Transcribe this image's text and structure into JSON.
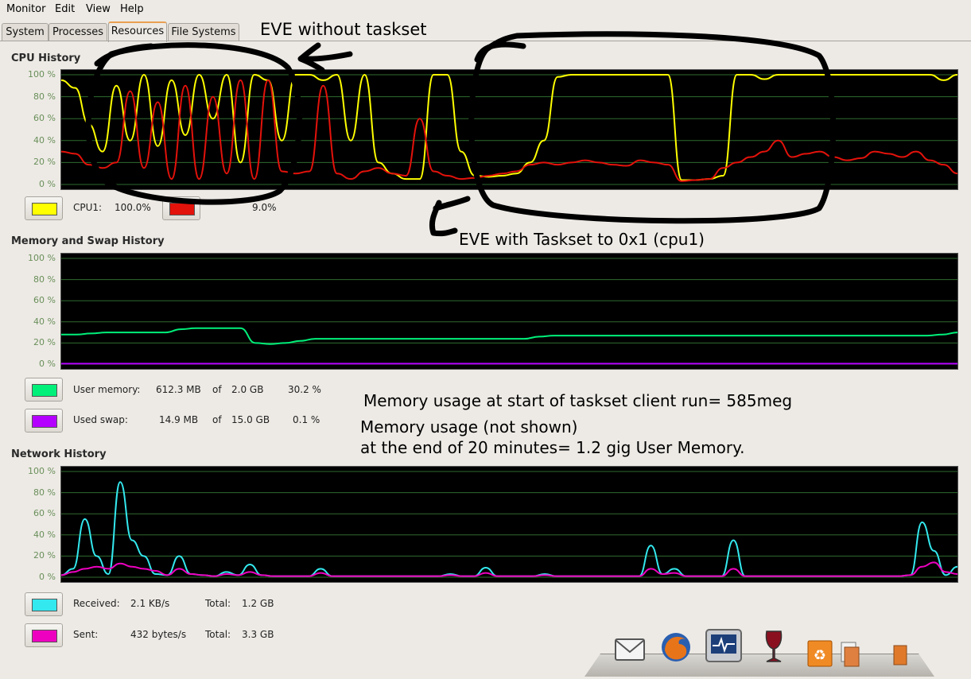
{
  "menu": {
    "monitor": {
      "label": "Monitor"
    },
    "edit": {
      "label": "Edit"
    },
    "view": {
      "label": "View"
    },
    "help": {
      "label": "Help"
    }
  },
  "tabs": [
    {
      "label": "System",
      "active": false
    },
    {
      "label": "Processes",
      "active": false
    },
    {
      "label": "Resources",
      "active": true
    },
    {
      "label": "File Systems",
      "active": false
    }
  ],
  "cpu": {
    "title": "CPU History",
    "ticks": [
      "100 %",
      "80 %",
      "60 %",
      "40 %",
      "20 %",
      "0 %"
    ],
    "legend": [
      {
        "name": "CPU1:",
        "value": "100.0%",
        "color": "#ffff00"
      },
      {
        "name": "",
        "value": "9.0%",
        "color": "#e3120b"
      }
    ]
  },
  "memory": {
    "title": "Memory and Swap History",
    "ticks": [
      "100 %",
      "80 %",
      "60 %",
      "40 %",
      "20 %",
      "0 %"
    ],
    "user": {
      "name": "User memory:",
      "used": "612.3 MB",
      "of": "of",
      "total": "2.0 GB",
      "percent": "30.2 %",
      "color": "#00f07a"
    },
    "swap": {
      "name": "Used swap:",
      "used": "14.9 MB",
      "of": "of",
      "total": "15.0 GB",
      "percent": "0.1 %",
      "color": "#b400ff"
    }
  },
  "network": {
    "title": "Network History",
    "ticks": [
      "100 %",
      "80 %",
      "60 %",
      "40 %",
      "20 %",
      "0 %"
    ],
    "received": {
      "name": "Received:",
      "rate": "2.1 KB/s",
      "total_label": "Total:",
      "total": "1.2 GB",
      "color": "#33e8ee"
    },
    "sent": {
      "name": "Sent:",
      "rate": "432 bytes/s",
      "total_label": "Total:",
      "total": "3.3 GB",
      "color": "#ee00c0"
    }
  },
  "annotations": {
    "eve_without": "EVE without taskset",
    "eve_with": "EVE with Taskset to 0x1 (cpu1)",
    "mem_start": "Memory usage at start of taskset client run= 585meg",
    "mem_note1": "Memory usage (not shown)",
    "mem_note2": "at the end of 20 minutes= 1.2 gig User Memory."
  },
  "dock": [
    "mail-icon",
    "firefox-icon",
    "system-monitor-icon",
    "wine-icon",
    "recycle-icon",
    "document-icon",
    "orange-doc-icon"
  ],
  "chart_data": [
    {
      "type": "line",
      "title": "CPU History",
      "ylim": [
        0,
        100
      ],
      "series": [
        {
          "name": "CPU1",
          "color": "#ffff00",
          "y": [
            95,
            88,
            55,
            30,
            90,
            40,
            100,
            35,
            95,
            45,
            100,
            60,
            100,
            20,
            100,
            95,
            40,
            100,
            100,
            95,
            100,
            40,
            100,
            20,
            10,
            5,
            5,
            100,
            100,
            30,
            8,
            7,
            8,
            10,
            20,
            40,
            98,
            100,
            100,
            100,
            100,
            100,
            100,
            100,
            100,
            4,
            4,
            5,
            8,
            100,
            100,
            96,
            100,
            100,
            100,
            100,
            100,
            100,
            100,
            100,
            100,
            100,
            100,
            100,
            95,
            100
          ]
        },
        {
          "name": "",
          "color": "#e3120b",
          "y": [
            30,
            28,
            18,
            15,
            20,
            85,
            15,
            75,
            5,
            90,
            5,
            80,
            10,
            95,
            5,
            95,
            12,
            10,
            12,
            90,
            10,
            5,
            12,
            15,
            10,
            8,
            60,
            12,
            8,
            5,
            6,
            8,
            10,
            12,
            18,
            20,
            18,
            20,
            22,
            20,
            18,
            17,
            22,
            20,
            18,
            3,
            4,
            5,
            15,
            20,
            25,
            30,
            40,
            25,
            28,
            30,
            25,
            22,
            24,
            30,
            28,
            25,
            30,
            22,
            18,
            10
          ]
        }
      ]
    },
    {
      "type": "line",
      "title": "Memory and Swap History",
      "ylim": [
        0,
        100
      ],
      "series": [
        {
          "name": "User memory",
          "color": "#00f07a",
          "y": [
            28,
            28,
            29,
            30,
            30,
            30,
            30,
            30,
            33,
            34,
            34,
            34,
            34,
            20,
            19,
            20,
            22,
            24,
            24,
            24,
            24,
            24,
            24,
            24,
            24,
            24,
            24,
            24,
            24,
            24,
            24,
            24,
            26,
            27,
            27,
            27,
            27,
            27,
            27,
            27,
            27,
            27,
            27,
            27,
            27,
            27,
            27,
            27,
            27,
            27,
            27,
            27,
            27,
            27,
            27,
            27,
            27,
            27,
            27,
            28,
            30
          ]
        },
        {
          "name": "Used swap",
          "color": "#b400ff",
          "y": [
            0.5,
            0.5,
            0.5,
            0.5,
            0.5,
            0.5,
            0.5,
            0.5,
            0.5,
            0.5,
            0.5,
            0.5,
            0.5,
            0.5,
            0.5,
            0.5,
            0.5,
            0.5,
            0.5,
            0.5,
            0.5,
            0.5,
            0.5,
            0.5,
            0.5,
            0.5,
            0.5,
            0.5,
            0.5,
            0.5,
            0.5,
            0.5,
            0.5,
            0.5,
            0.5,
            0.5,
            0.5,
            0.5,
            0.5,
            0.5,
            0.5,
            0.5,
            0.5,
            0.5,
            0.5,
            0.5,
            0.5,
            0.5,
            0.5,
            0.5,
            0.5,
            0.5,
            0.5,
            0.5,
            0.5,
            0.5,
            0.5,
            0.5,
            0.5,
            0.5,
            0.5
          ]
        }
      ]
    },
    {
      "type": "line",
      "title": "Network History",
      "ylim": [
        0,
        100
      ],
      "series": [
        {
          "name": "Received",
          "color": "#33e8ee",
          "y": [
            2,
            8,
            55,
            20,
            3,
            90,
            35,
            20,
            3,
            2,
            20,
            3,
            2,
            1,
            5,
            2,
            12,
            2,
            1,
            1,
            1,
            1,
            8,
            1,
            1,
            1,
            1,
            1,
            1,
            1,
            1,
            1,
            1,
            3,
            1,
            1,
            9,
            1,
            1,
            1,
            1,
            3,
            1,
            1,
            1,
            1,
            1,
            1,
            1,
            1,
            30,
            3,
            8,
            1,
            1,
            1,
            1,
            35,
            1,
            1,
            1,
            1,
            1,
            1,
            1,
            1,
            1,
            1,
            1,
            1,
            1,
            1,
            2,
            52,
            25,
            2,
            10
          ]
        },
        {
          "name": "Sent",
          "color": "#ee00c0",
          "y": [
            2,
            5,
            8,
            10,
            8,
            13,
            10,
            8,
            6,
            2,
            8,
            3,
            2,
            1,
            3,
            2,
            5,
            2,
            1,
            1,
            1,
            1,
            4,
            1,
            1,
            1,
            1,
            1,
            1,
            1,
            1,
            1,
            1,
            2,
            1,
            1,
            4,
            1,
            1,
            1,
            1,
            2,
            1,
            1,
            1,
            1,
            1,
            1,
            1,
            1,
            8,
            3,
            4,
            1,
            1,
            1,
            1,
            8,
            1,
            1,
            1,
            1,
            1,
            1,
            1,
            1,
            1,
            1,
            1,
            1,
            1,
            1,
            2,
            10,
            14,
            5,
            3
          ]
        }
      ]
    }
  ]
}
